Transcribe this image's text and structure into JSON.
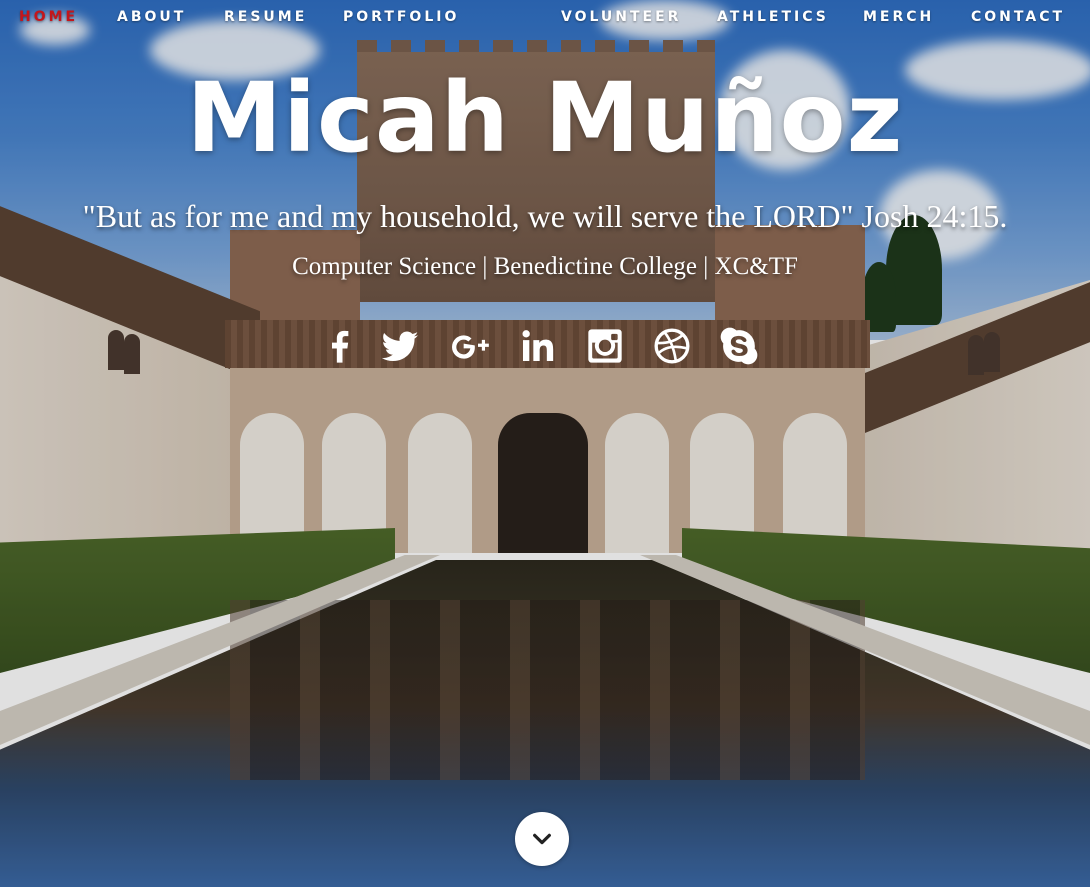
{
  "nav": {
    "items": [
      {
        "label": "HOME",
        "active": true
      },
      {
        "label": "ABOUT"
      },
      {
        "label": "RESUME"
      },
      {
        "label": "PORTFOLIO"
      },
      {
        "label": "VOLUNTEER"
      },
      {
        "label": "ATHLETICS"
      },
      {
        "label": "MERCH"
      },
      {
        "label": "CONTACT"
      }
    ],
    "active_color": "#c4161c"
  },
  "hero": {
    "title": "Micah Muñoz",
    "quote": "\"But as for me and my household, we will serve the LORD\" Josh 24:15.",
    "subtitle": "Computer Science | Benedictine College | XC&TF"
  },
  "social": [
    "facebook-icon",
    "twitter-icon",
    "google-plus-icon",
    "linkedin-icon",
    "instagram-icon",
    "dribbble-icon",
    "skype-icon"
  ],
  "scroll": {
    "icon": "chevron-down-icon"
  }
}
